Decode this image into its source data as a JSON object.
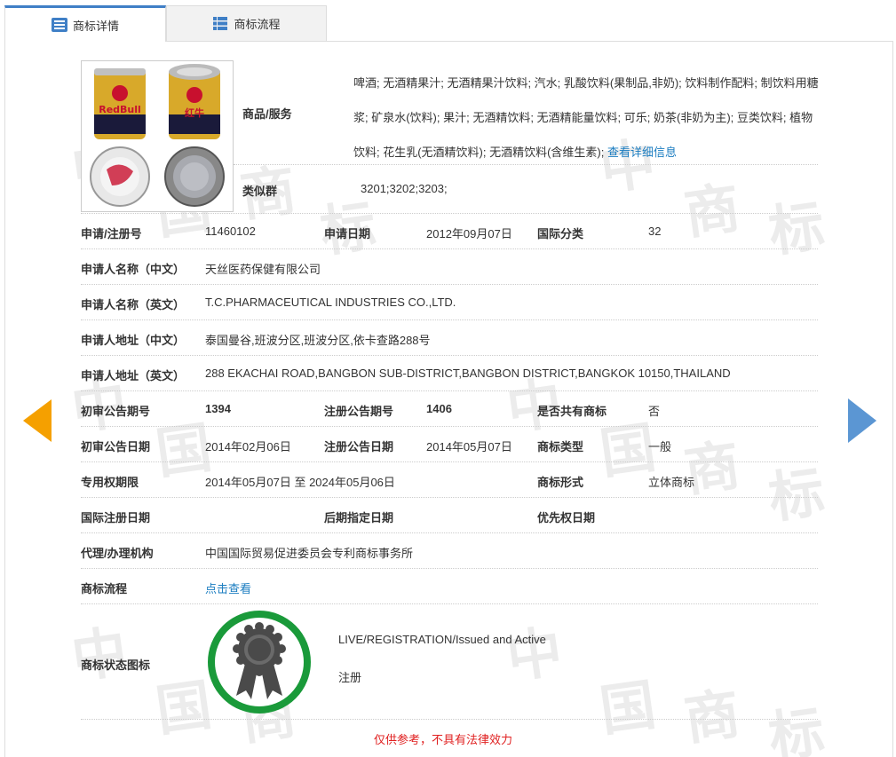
{
  "tabs": [
    {
      "label": "商标详情",
      "icon": "list-icon",
      "active": true
    },
    {
      "label": "商标流程",
      "icon": "grid-icon",
      "active": false
    }
  ],
  "watermark": [
    "中",
    "国",
    "商",
    "标"
  ],
  "image_alt": "Red Bull 红牛 can trademark image",
  "can_text": "RedBull",
  "can_text_cn": "红牛",
  "goods_services": {
    "label": "商品/服务",
    "text": "啤酒; 无酒精果汁; 无酒精果汁饮料; 汽水; 乳酸饮料(果制品,非奶); 饮料制作配料; 制饮料用糖浆; 矿泉水(饮料); 果汁; 无酒精饮料; 无酒精能量饮料; 可乐; 奶茶(非奶为主); 豆类饮料; 植物饮料; 花生乳(无酒精饮料); 无酒精饮料(含维生素);",
    "more_link": "查看详细信息"
  },
  "similar_group": {
    "label": "类似群",
    "value": "3201;3202;3203;"
  },
  "reg_no": {
    "label": "申请/注册号",
    "value": "11460102"
  },
  "app_date": {
    "label": "申请日期",
    "value": "2012年09月07日"
  },
  "intl_class": {
    "label": "国际分类",
    "value": "32"
  },
  "applicant_cn": {
    "label": "申请人名称（中文）",
    "value": "天丝医药保健有限公司"
  },
  "applicant_en": {
    "label": "申请人名称（英文）",
    "value": "T.C.PHARMACEUTICAL INDUSTRIES CO.,LTD."
  },
  "address_cn": {
    "label": "申请人地址（中文）",
    "value": "泰国曼谷,班波分区,班波分区,依卡查路288号"
  },
  "address_en": {
    "label": "申请人地址（英文）",
    "value": "288 EKACHAI ROAD,BANGBON SUB-DISTRICT,BANGBON DISTRICT,BANGKOK 10150,THAILAND"
  },
  "prelim_issue": {
    "label": "初审公告期号",
    "value": "1394"
  },
  "reg_issue": {
    "label": "注册公告期号",
    "value": "1406"
  },
  "shared": {
    "label": "是否共有商标",
    "value": "否"
  },
  "prelim_date": {
    "label": "初审公告日期",
    "value": "2014年02月06日"
  },
  "reg_date": {
    "label": "注册公告日期",
    "value": "2014年05月07日"
  },
  "tm_type": {
    "label": "商标类型",
    "value": "一般"
  },
  "exclusive_period": {
    "label": "专用权期限",
    "value": "2014年05月07日 至 2024年05月06日"
  },
  "tm_form": {
    "label": "商标形式",
    "value": "立体商标"
  },
  "intl_reg_date": {
    "label": "国际注册日期",
    "value": ""
  },
  "later_designation": {
    "label": "后期指定日期",
    "value": ""
  },
  "priority_date": {
    "label": "优先权日期",
    "value": ""
  },
  "agent": {
    "label": "代理/办理机构",
    "value": "中国国际贸易促进委员会专利商标事务所"
  },
  "flow": {
    "label": "商标流程",
    "link": "点击查看"
  },
  "status": {
    "label": "商标状态图标",
    "en": "LIVE/REGISTRATION/Issued and Active",
    "cn": "注册",
    "ring_color": "#1a9a3a",
    "badge_color": "#4a4a4a"
  },
  "disclaimer": "仅供参考，不具有法律效力",
  "colors": {
    "accent": "#3f7fc6",
    "link": "#1a7cc0",
    "left_arrow": "#f5a000",
    "right_arrow": "#5b96d3",
    "disclaimer": "#e02020"
  }
}
